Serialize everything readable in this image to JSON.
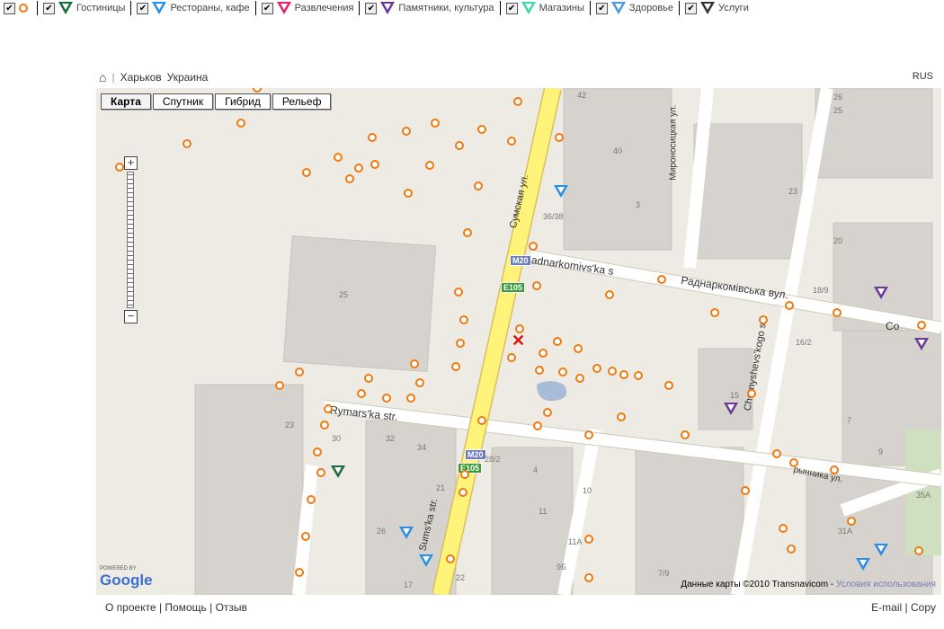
{
  "filters": [
    {
      "label": "",
      "color": "#ee7a10",
      "shape": "circle",
      "checked": true
    },
    {
      "label": "Гостиницы",
      "color": "#1a6b3c",
      "checked": true
    },
    {
      "label": "Рестораны, кафе",
      "color": "#2a8ee8",
      "checked": true
    },
    {
      "label": "Развлечения",
      "color": "#e8206a",
      "checked": true
    },
    {
      "label": "Памятники, культура",
      "color": "#6a3a9a",
      "checked": true
    },
    {
      "label": "Магазины",
      "color": "#3ed8a8",
      "checked": true
    },
    {
      "label": "Здоровье",
      "color": "#4a9ae0",
      "checked": true
    },
    {
      "label": "Услуги",
      "color": "#333333",
      "checked": true
    }
  ],
  "breadcrumb": {
    "sep": "|",
    "city": "Харьков",
    "country": "Украина"
  },
  "lang": "RUS",
  "map": {
    "types": [
      "Карта",
      "Спутник",
      "Гибрид",
      "Рельеф"
    ],
    "active": "Карта",
    "zoom_in": "+",
    "zoom_out": "−",
    "streets": [
      "Сумская ул.",
      "Radnarkomivs'ka s",
      "Раднаркомівська вул.",
      "Rymars'ka str.",
      "Sums'ka str.",
      "Chernyshevs'kogo str.",
      "Мироносицкая ул.",
      "рынника ул.",
      "Со"
    ],
    "shields": [
      "M20",
      "E105",
      "M20",
      "E105"
    ],
    "house_numbers": [
      "25",
      "42",
      "40",
      "3",
      "36/38",
      "23",
      "20",
      "26",
      "25",
      "18/9",
      "16/2",
      "15",
      "7",
      "9",
      "23",
      "30",
      "32",
      "34",
      "21",
      "26",
      "28/2",
      "4",
      "11",
      "10",
      "31А",
      "35А",
      "7/9",
      "9Б",
      "22",
      "17",
      "11А"
    ],
    "credit": "Данные карты ©2010 Transnavicom - ",
    "terms": "Условия использования",
    "logo_powered": "POWERED BY",
    "logo": "Google"
  },
  "footer": {
    "left": [
      "О проекте",
      "Помощь",
      "Отзыв"
    ],
    "right": [
      "E-mail",
      "Copy"
    ]
  }
}
